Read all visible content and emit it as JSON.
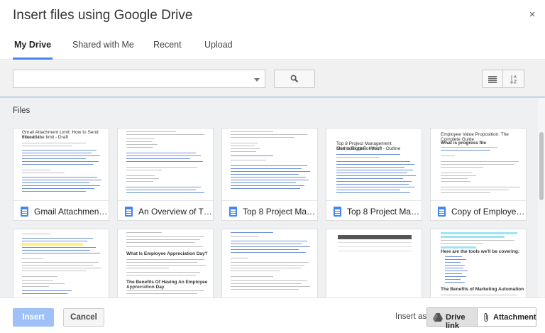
{
  "dialog": {
    "title": "Insert files using Google Drive",
    "close_glyph": "×"
  },
  "tabs": [
    {
      "label": "My Drive",
      "active": true
    },
    {
      "label": "Shared with Me",
      "active": false
    },
    {
      "label": "Recent",
      "active": false
    },
    {
      "label": "Upload",
      "active": false
    }
  ],
  "toolbar": {
    "select_value": "",
    "icons": {
      "search": "search-icon",
      "list_view": "list-view-icon",
      "sort": "sort-az-icon"
    }
  },
  "section_label": "Files",
  "files": [
    {
      "name": "Gmail Attachment Limit: How to Send Files that exceed the limit",
      "display": "Gmail Attachment ...",
      "type": "document"
    },
    {
      "name": "An Overview of The...",
      "display": "An Overview of Th...",
      "type": "document"
    },
    {
      "name": "Top 8 Project Management Methodologies",
      "display": "Top 8 Project Man...",
      "type": "document"
    },
    {
      "name": "Top 8 Project Management Methodologies: Which One Is Right For You? - Outline",
      "display": "Top 8 Project Man...",
      "type": "document"
    },
    {
      "name": "Copy of Employee Value Proposition: The Complete Guide",
      "display": "Copy of Employee ...",
      "type": "document"
    },
    {
      "name": "",
      "display": "",
      "type": "document"
    },
    {
      "name": "",
      "display": "",
      "type": "document"
    },
    {
      "name": "",
      "display": "",
      "type": "document"
    },
    {
      "name": "",
      "display": "",
      "type": "document"
    },
    {
      "name": "",
      "display": "",
      "type": "document"
    }
  ],
  "thumbnails": {
    "t0": [
      "Gmail Attachment Limit: How to Send Files that",
      "exceed the limit - Draft"
    ],
    "t3": [
      "Top 8 Project Management Methodologies: Which",
      "One Is Right For You? - Outline"
    ],
    "t4": [
      "Employee Value Proposition: The Complete Guide",
      "What is progress file"
    ],
    "t6": [
      "What Is Employee Appreciation Day?",
      "The Benefits Of Having An Employee Appreciation Day"
    ],
    "t9": [
      "Here are the tools we'll be covering:",
      "The Benefits of Marketing Automation"
    ]
  },
  "footer": {
    "insert_label": "Insert",
    "cancel_label": "Cancel",
    "insert_as_label": "Insert as",
    "drive_link_label": "Drive link",
    "attachment_label": "Attachment"
  },
  "colors": {
    "accent": "#4285f4",
    "insert_disabled": "#a0c1f7",
    "doc_icon": "#4285f4",
    "highlight_cyan": "#9fe3f1",
    "highlight_yellow": "#fdf27a"
  }
}
